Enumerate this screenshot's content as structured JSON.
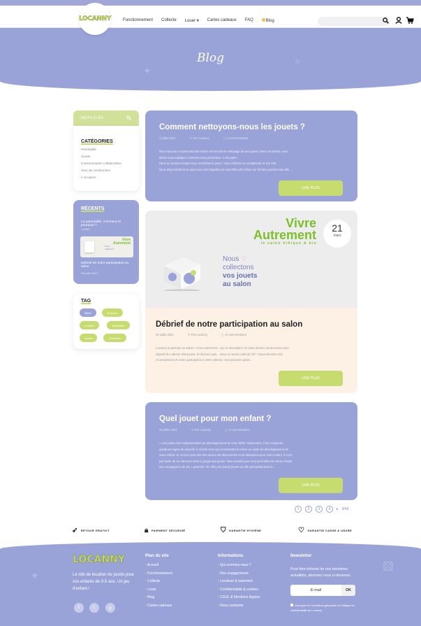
{
  "brand": {
    "logo": "LOCANNY"
  },
  "nav": {
    "items": [
      "Fonctionnement",
      "Collecte",
      "Louer ▾",
      "Cartes cadeaux",
      "FAQ"
    ],
    "active": "Blog"
  },
  "search": {
    "placeholder": ""
  },
  "icons": {
    "search": "search-icon",
    "user": "user-icon",
    "cart": "cart-icon"
  },
  "hero": {
    "title": "Blog"
  },
  "sidebar": {
    "keywords_label": "MOTS CLÉS",
    "categories_title": "CATÉGORIES",
    "categories": [
      "Parentalité",
      "Jouets",
      "Consommation collaborative",
      "Jeux de construction",
      "L'occasion"
    ],
    "recent_title": "RÉCENTS",
    "recent": [
      {
        "title": "La parentalité, comment et pourquoi ?",
        "date": "1 juillet"
      },
      {
        "title": "Débrief de notre participation au salon",
        "date": "20 juillet 2021"
      }
    ],
    "tag_title": "TAG",
    "tags": [
      "Bebe",
      "Enfance",
      "Location",
      "Education",
      "Jouets",
      "Occasion"
    ]
  },
  "posts": [
    {
      "title": "Comment nettoyons-nous les jouets ?",
      "date": "1 juillet 2021",
      "author": "Par Locanny",
      "comments": "3 commentaires",
      "lines": [
        "Nous suivons un protocole très stricte concernant le nettoyage de nos jouets. Dans cet article, nous",
        "allons vous expliquer comment nous procédons. C'est parti !",
        "Dans un premier temps nous contrôlons le jouet : nous vérifions sa complétude et son état.",
        "Nous dépoussiérons le jouet avec des lingettes en microfibre afin d'ôter sur de bien pousser tout afin ..."
      ],
      "more": "LIRE PLUS"
    },
    {
      "title": "Débrief de notre participation au salon",
      "date": "20 juillet 2021",
      "author": "Par Locanny",
      "comments": "9 commentaires",
      "image": {
        "brand_line1": "Vivre",
        "brand_line2": "Autrement",
        "subtitle": "le salon éthique & bio",
        "day": "21",
        "month": "mars",
        "nous": "Nous",
        "collectons": "collectons",
        "vos_jouets": "vos jouets",
        "au_salon": "au salon"
      },
      "lines": [
        "Locanny à participé au Salon « Vivre autrement » qui se déroulait le 21 mars dernier. Nous avions pour",
        "objectif de collecter 300 jouets. Et devinez quoi... Nous en avons collecté 357 ! Nous sommes très",
        "reconnaissant de votre participation à cette collecte, nous pouvons grâce..."
      ],
      "more": "LIRE PLUS"
    },
    {
      "title": "Quel jouet pour mon enfant ?",
      "date": "26 juillet 2021",
      "author": "Par Locanny",
      "comments": "8 commentaires",
      "lines": [
        "« Les jouets sont indispensables au développement de votre bébé. Néanmoins, il faut respecter",
        "quelques règles de sécurité et choisir ceux qui conviennent le mieux au stade de développement de",
        "votre enfant. Si un bon jouet doit être source de découvertes et de distraction pour votre enfant, il n'est",
        "pas facile de se retrouver dans la jungle des jouets. Nos conseils pour vous permettre de mieux choisir",
        "ses compagnons de jeu » parents?. En effet, les jouets jouent un rôle primordial dans le..."
      ],
      "more": "LIRE PLUS"
    }
  ],
  "pagination": {
    "pages": [
      "1",
      "2",
      "3",
      "4"
    ],
    "next": "▸",
    "total": "3/43"
  },
  "features": [
    "RETOUR GRATUIT",
    "PAIEMENT SÉCURISÉ",
    "GARANTIE HYGIÈNE",
    "GARANTIE CASSE & USURE"
  ],
  "footer": {
    "tagline": "Le site de location de jouets pour vos enfants de 0-5 ans. Un jeu d'enfant !",
    "plan_title": "Plan du site",
    "plan": [
      "Accueil",
      "Fonctionnement",
      "Collecte",
      "Louer",
      "Blog",
      "Cartes cadeaux"
    ],
    "info_title": "Informations",
    "info": [
      "Qui sommes-nous ?",
      "Nos engagements",
      "Livraison & paiement",
      "Confidentialité & cookies",
      "CGUL & Mentions légales",
      "Nous contacter"
    ],
    "newsletter_title": "Newsletter",
    "newsletter_text": "Pour être informé de nos dernières actualités, abonnez vous ci-dessous.",
    "email_placeholder": "E-mail",
    "ok": "OK",
    "consent": "J'accepte les Conditions générales et Politique de confidentialité de Locanny."
  }
}
